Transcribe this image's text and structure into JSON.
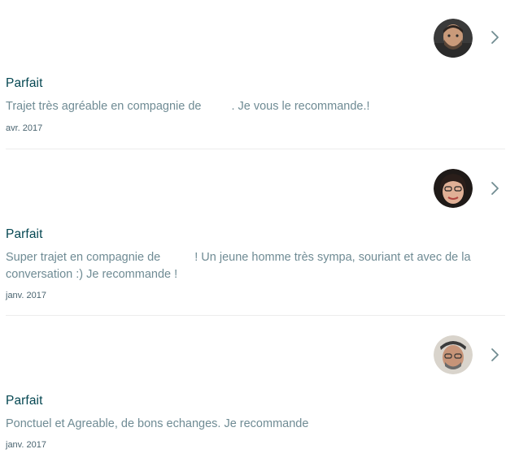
{
  "reviews": [
    {
      "rating_label": "Parfait",
      "comment_before_name": "Trajet très agréable en compagnie de",
      "comment_after_name": ". Je vous le recommande.!",
      "date": "avr. 2017",
      "avatar_icon": "user-avatar-1"
    },
    {
      "rating_label": "Parfait",
      "comment_before_name": "Super trajet en compagnie de",
      "comment_after_name": "! Un jeune homme très sympa, souriant et avec de la conversation :) Je recommande !",
      "date": "janv. 2017",
      "avatar_icon": "user-avatar-2"
    },
    {
      "rating_label": "Parfait",
      "comment_before_name": "Ponctuel et Agreable, de bons echanges. Je recommande",
      "comment_after_name": "",
      "date": "janv. 2017",
      "avatar_icon": "user-avatar-3"
    }
  ],
  "colors": {
    "title": "#054752",
    "comment": "#6f8b94",
    "date": "#4a6470",
    "chevron": "#708c91",
    "divider": "#ececec"
  },
  "icons": {
    "chevron": "chevron-right-icon"
  }
}
